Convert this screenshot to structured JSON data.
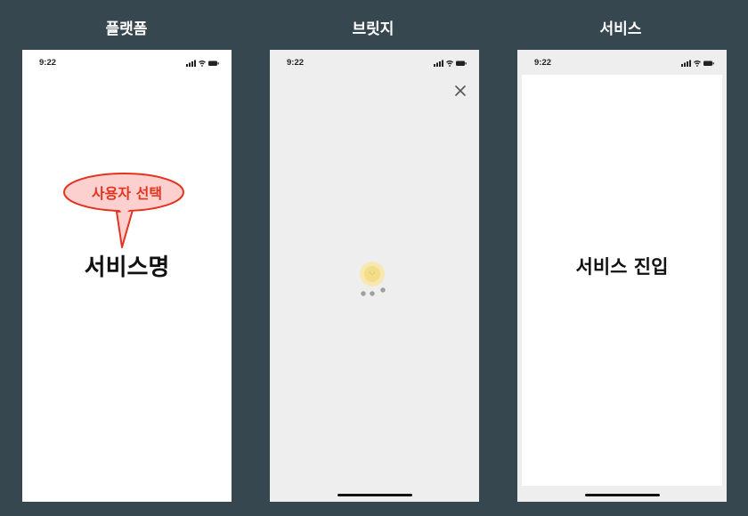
{
  "columns": {
    "platform": {
      "title": "플랫폼",
      "status_time": "9:22",
      "callout": "사용자 선택",
      "service_name": "서비스명"
    },
    "bridge": {
      "title": "브릿지",
      "status_time": "9:22",
      "close_icon": "close-icon",
      "loading_icon": "loading-bulb-icon"
    },
    "service": {
      "title": "서비스",
      "status_time": "9:22",
      "service_entry": "서비스 진입"
    }
  },
  "colors": {
    "background": "#37474f",
    "callout_fill": "#fbd0cf",
    "callout_stroke": "#e3341f",
    "callout_text": "#e3341f",
    "bridge_bg": "#eeeeee",
    "service_frame": "#eeeeee"
  }
}
